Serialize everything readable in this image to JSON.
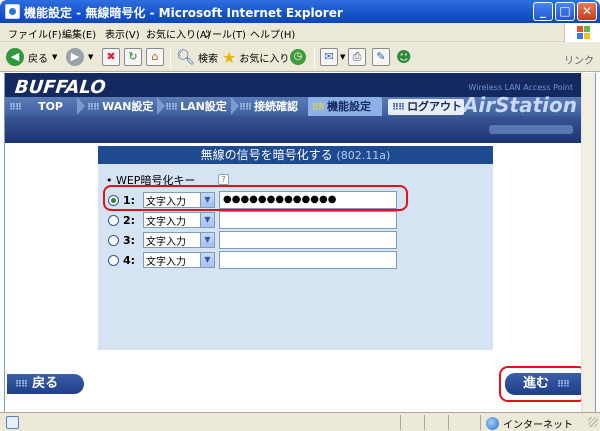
{
  "window": {
    "title": "機能設定 - 無線暗号化 - Microsoft Internet Explorer",
    "minimize": "_",
    "maximize": "□",
    "close": "✕"
  },
  "menu": [
    "ファイル(F)",
    "編集(E)",
    "表示(V)",
    "お気に入り(A)",
    "ツール(T)",
    "ヘルプ(H)"
  ],
  "toolbar": {
    "back": "戻る",
    "search": "検索",
    "favorites": "お気に入り",
    "links": "リンク"
  },
  "header": {
    "logo": "BUFFALO",
    "product_label": "Wireless LAN Access Point",
    "product": "AirStation"
  },
  "nav": [
    {
      "label": "TOP",
      "active": false
    },
    {
      "label": "WAN設定",
      "active": false
    },
    {
      "label": "LAN設定",
      "active": false
    },
    {
      "label": "接続確認",
      "active": false
    },
    {
      "label": "機能設定",
      "active": true
    },
    {
      "label": "ログアウト",
      "active": false
    }
  ],
  "panel": {
    "title": "無線の信号を暗号化する",
    "subtitle": "(802.11a)",
    "wep_label": "• WEP暗号化キー",
    "help": "?",
    "keys": [
      {
        "number": "1:",
        "mode": "文字入力",
        "value": "●●●●●●●●●●●●●",
        "selected": true
      },
      {
        "number": "2:",
        "mode": "文字入力",
        "value": "",
        "selected": false
      },
      {
        "number": "3:",
        "mode": "文字入力",
        "value": "",
        "selected": false
      },
      {
        "number": "4:",
        "mode": "文字入力",
        "value": "",
        "selected": false
      }
    ]
  },
  "buttons": {
    "back": "戻る",
    "next": "進む"
  },
  "status": {
    "zone": "インターネット"
  },
  "colors": {
    "header_bg": "#14295f",
    "panel_bg": "#d6e3f3",
    "panel_head": "#1e4a92",
    "highlight": "#e3111b"
  }
}
